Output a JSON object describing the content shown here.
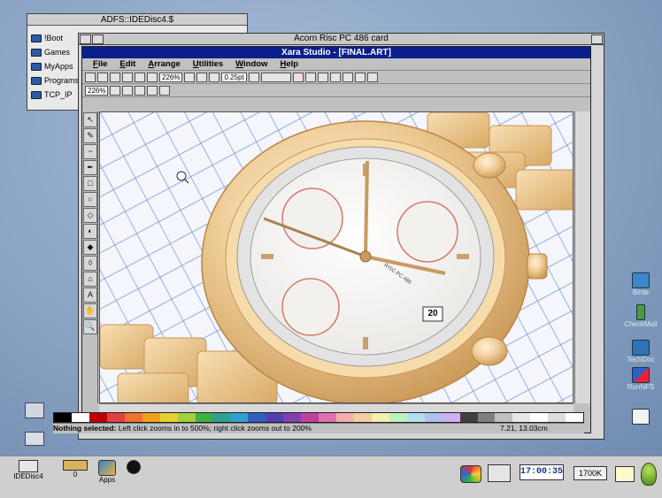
{
  "filer": {
    "title": "ADFS::IDEDisc4.$",
    "items": [
      "!Boot",
      "Games",
      "MyApps",
      "Programs",
      "TCP_IP"
    ]
  },
  "card_window": {
    "title": "Acorn Risc PC 486 card"
  },
  "xara": {
    "title": "Xara Studio - [FINAL.ART]",
    "menu": [
      "File",
      "Edit",
      "Arrange",
      "Utilities",
      "Window",
      "Help"
    ],
    "zoom": "226%",
    "line_width": "0.25pt",
    "zoom2": "226%",
    "status_selection": "Nothing selected:",
    "status_hint": "Left click zooms in to 500%; right click zooms out to 200%",
    "coordinates": "7.21, 13.03cm",
    "watch_date": "20",
    "watch_brand": "RISC PC 486"
  },
  "desktop_icons": [
    "Birds",
    "CheckMail",
    "TechDoc",
    "RunNFS",
    ""
  ],
  "iconbar": {
    "drive_label": "IDEDisc4",
    "ram_label": "0",
    "apps_label": "Apps",
    "clock": "17:00:35",
    "memory": "1700K"
  },
  "colors": {
    "title_active": "#0a1e8c",
    "desktop": "#8da7c9",
    "gold": "#e7c38d"
  }
}
